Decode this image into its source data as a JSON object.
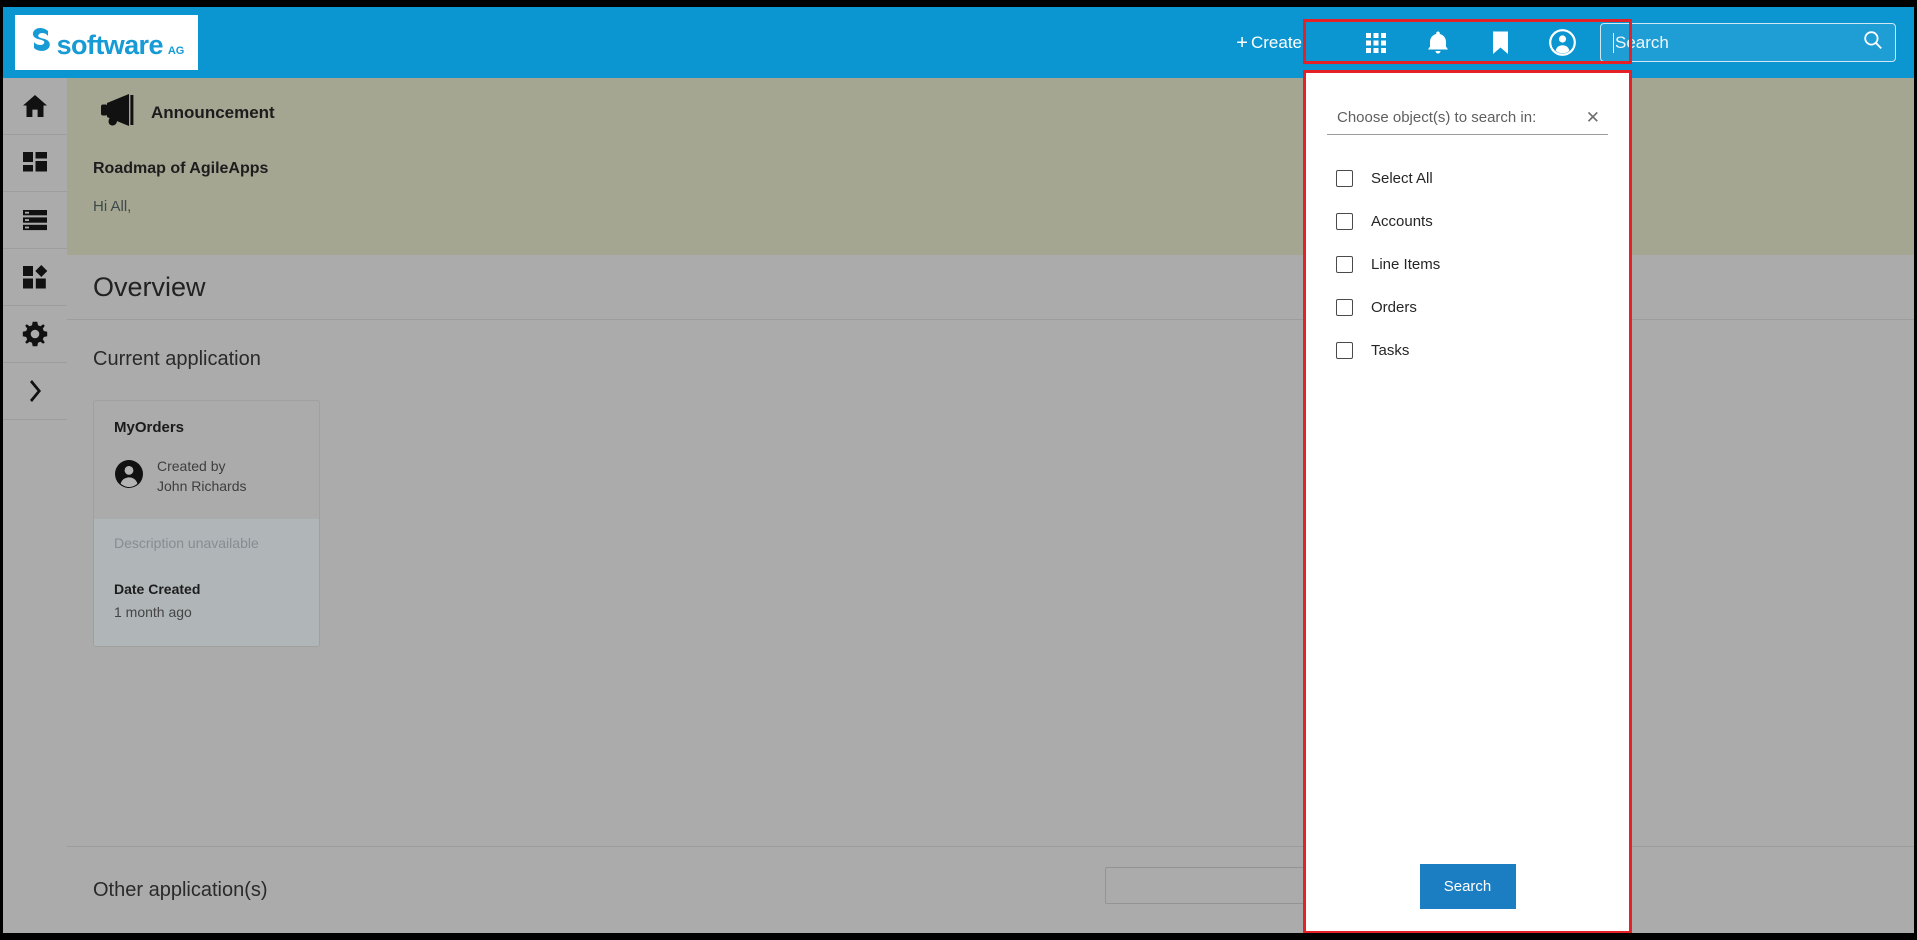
{
  "colors": {
    "header_blue": "#0b96d1",
    "highlight_red": "#e52128",
    "overlay_gray": "#ababab",
    "announcement_bg": "#a5a692",
    "primary_button": "#1b7ec2",
    "logo_blue": "#169bd5"
  },
  "header": {
    "logo_word": "software",
    "logo_superscript": "AG",
    "create_label": "Create",
    "create_plus": "+",
    "icons": [
      {
        "name": "apps-grid-icon",
        "label": "Apps"
      },
      {
        "name": "bell-icon",
        "label": "Notifications"
      },
      {
        "name": "bookmark-icon",
        "label": "Bookmarks"
      },
      {
        "name": "account-circle-icon",
        "label": "Account"
      }
    ],
    "search": {
      "placeholder": "Search",
      "value": "",
      "icon": "magnifier-icon"
    }
  },
  "sidebar": {
    "items": [
      {
        "icon": "home-icon",
        "label": "Home"
      },
      {
        "icon": "dashboard-icon",
        "label": "Dashboard"
      },
      {
        "icon": "list-icon",
        "label": "List"
      },
      {
        "icon": "apps-diamond-icon",
        "label": "Applications"
      },
      {
        "icon": "gear-icon",
        "label": "Settings"
      },
      {
        "icon": "chevron-right-icon",
        "label": "Expand"
      }
    ]
  },
  "main": {
    "announcement": {
      "icon": "megaphone-icon",
      "title": "Announcement",
      "subject": "Roadmap of AgileApps",
      "body": "Hi All,"
    },
    "overview_title": "Overview",
    "current_application_label": "Current application",
    "app_card": {
      "name": "MyOrders",
      "avatar_icon": "account-circle-icon",
      "created_by_label": "Created by",
      "created_by_name": "John Richards",
      "description": "Description unavailable",
      "date_created_label": "Date Created",
      "date_created_value": "1 month ago"
    },
    "other_applications_label": "Other application(s)",
    "other_search": {
      "placeholder": "",
      "value": ""
    }
  },
  "search_dropdown": {
    "title": "Choose object(s) to search in:",
    "close_icon": "close-icon",
    "options": [
      {
        "label": "Select All",
        "checked": false
      },
      {
        "label": "Accounts",
        "checked": false
      },
      {
        "label": "Line Items",
        "checked": false
      },
      {
        "label": "Orders",
        "checked": false
      },
      {
        "label": "Tasks",
        "checked": false
      }
    ],
    "search_button_label": "Search"
  }
}
